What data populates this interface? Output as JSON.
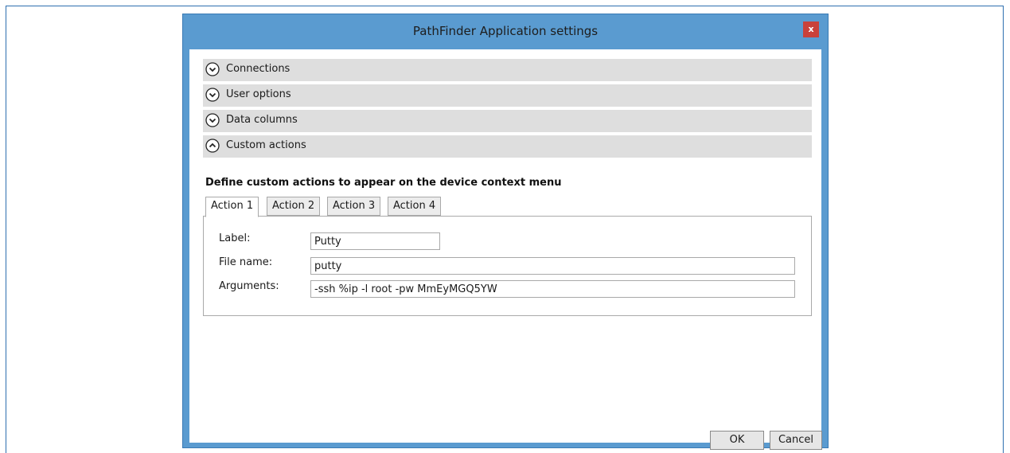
{
  "window": {
    "title": "PathFinder Application settings",
    "close_label": "x"
  },
  "sections": [
    {
      "label": "Connections",
      "icon": "chevron-down-circle-icon",
      "expanded": false
    },
    {
      "label": "User options",
      "icon": "chevron-down-circle-icon",
      "expanded": false
    },
    {
      "label": "Data columns",
      "icon": "chevron-down-circle-icon",
      "expanded": false
    },
    {
      "label": "Custom actions",
      "icon": "chevron-up-circle-icon",
      "expanded": true
    }
  ],
  "custom_actions": {
    "description": "Define custom actions to appear on the device context menu",
    "tabs": [
      {
        "label": "Action 1",
        "active": true
      },
      {
        "label": "Action 2",
        "active": false
      },
      {
        "label": "Action 3",
        "active": false
      },
      {
        "label": "Action 4",
        "active": false
      }
    ],
    "fields": {
      "label": {
        "label": "Label:",
        "value": "Putty"
      },
      "file_name": {
        "label": "File name:",
        "value": "putty"
      },
      "arguments": {
        "label": "Arguments:",
        "value": "-ssh %ip -l root -pw MmEyMGQ5YW"
      }
    }
  },
  "buttons": {
    "ok": "OK",
    "cancel": "Cancel"
  },
  "colors": {
    "window_frame": "#5a9bd0",
    "close_button": "#c9413a",
    "section_header": "#dedede"
  }
}
